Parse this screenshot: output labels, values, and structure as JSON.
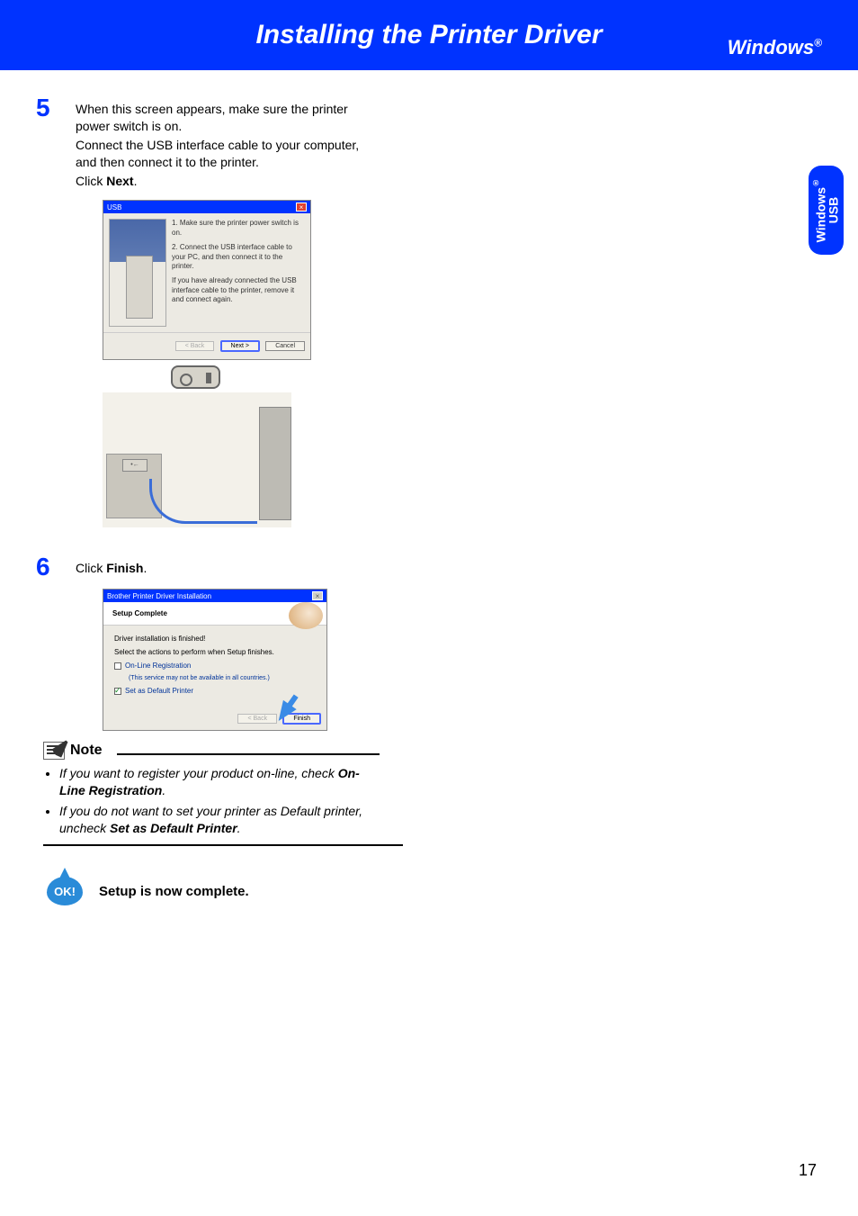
{
  "header": {
    "title": "Installing the Printer Driver",
    "os": "Windows",
    "os_sup": "®"
  },
  "side_tab": {
    "line1": "Windows",
    "line1_sup": "®",
    "line2": "USB"
  },
  "step5": {
    "num": "5",
    "p1": "When this screen appears, make sure the printer power switch is on.",
    "p2": "Connect the USB interface cable to your computer, and then connect it to the printer.",
    "p3a": "Click ",
    "p3b": "Next",
    "p3c": "."
  },
  "dlg1": {
    "title": "USB",
    "t1": "1. Make sure the printer power switch is on.",
    "t2": "2. Connect the USB interface cable to your PC, and then connect it to the printer.",
    "t3": "If you have already connected the USB interface cable to the printer, remove it and connect again.",
    "btn_back": "< Back",
    "btn_next": "Next >",
    "btn_cancel": "Cancel"
  },
  "photo": {
    "usb_label": "•←"
  },
  "step6": {
    "num": "6",
    "a": "Click ",
    "b": "Finish",
    "c": "."
  },
  "dlg2": {
    "title": "Brother Printer Driver Installation",
    "head": "Setup Complete",
    "line1": "Driver installation is finished!",
    "line2": "Select the actions to perform when Setup finishes.",
    "chk1": "On-Line Registration",
    "svc": "(This service may not be available in all countries.)",
    "chk2": "Set as Default Printer",
    "btn_back": "< Back",
    "btn_finish": "Finish"
  },
  "note": {
    "title": "Note",
    "li1a": "If you want to register your product on-line, check ",
    "li1b": "On-Line Registration",
    "li1c": ".",
    "li2a": "If you do not want to set your printer as Default printer, uncheck ",
    "li2b": "Set as Default Printer",
    "li2c": "."
  },
  "ok": {
    "badge": "OK!",
    "text": "Setup is now complete."
  },
  "page_number": "17"
}
